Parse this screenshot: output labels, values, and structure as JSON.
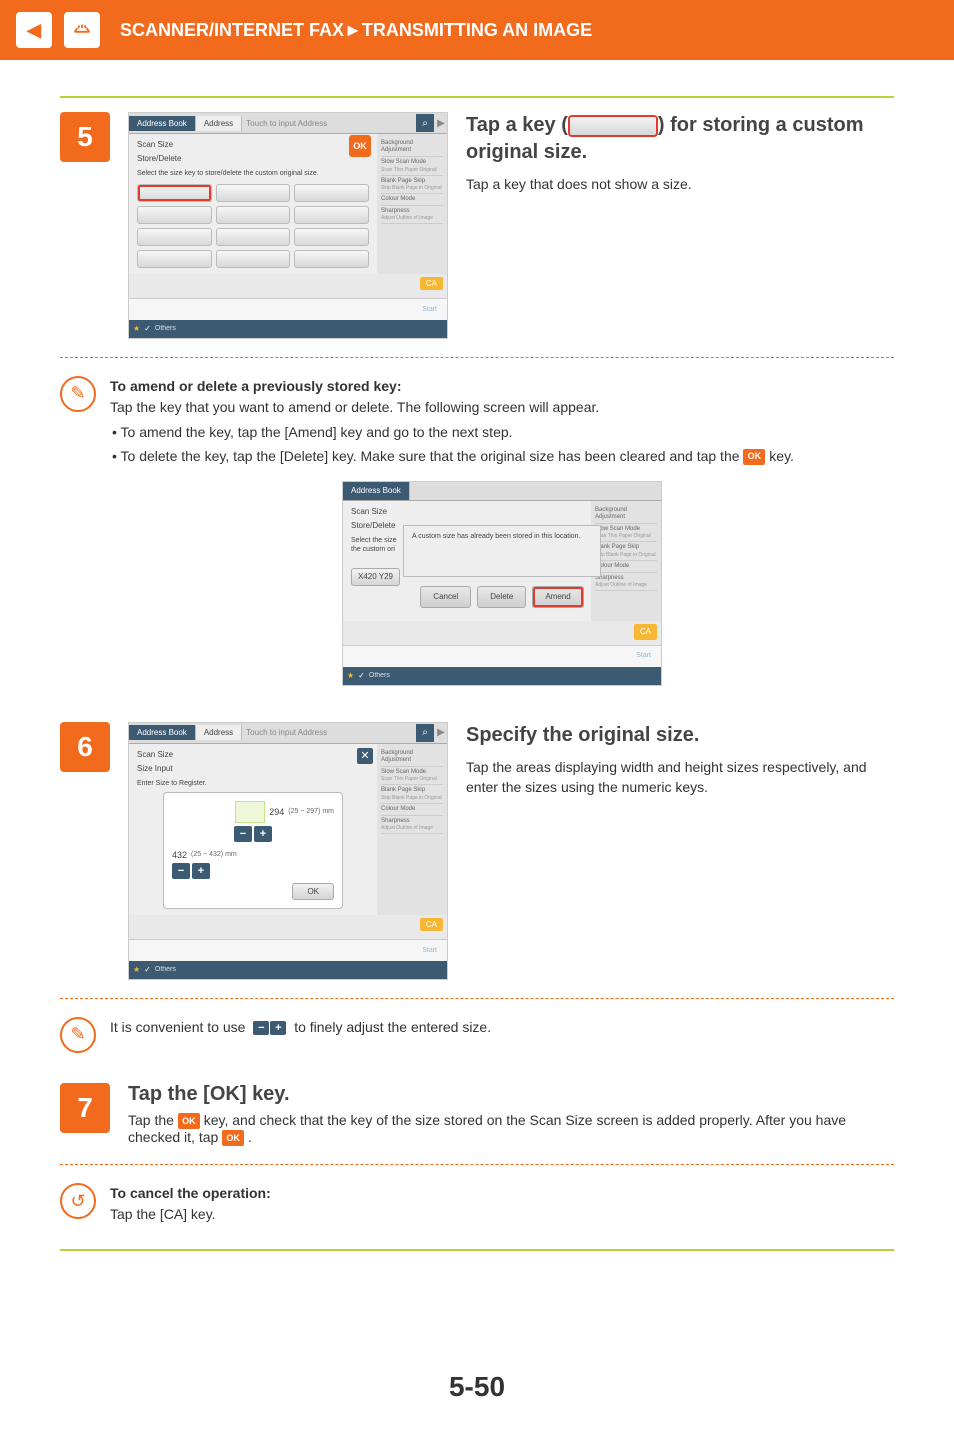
{
  "header": {
    "breadcrumb": "SCANNER/INTERNET FAX►TRANSMITTING AN IMAGE"
  },
  "step5": {
    "num": "5",
    "title_a": "Tap a key (",
    "title_b": ") for storing a custom original size.",
    "desc": "Tap a key that does not show a size."
  },
  "mock_common": {
    "tab_book": "Address Book",
    "tab_address": "Address",
    "hint": "Touch to input Address",
    "right": {
      "bg_adjust": "Background Adjustment",
      "slow": "Slow Scan Mode",
      "slow_sub": "Scan Thin Paper Original",
      "blank": "Blank Page Skip",
      "blank_sub": "Skip Blank Page in Original",
      "colour": "Colour Mode",
      "sharp": "Sharpness",
      "sharp_sub": "Adjust Outline of Image"
    },
    "ca": "CA",
    "ok": "OK",
    "others": "Others",
    "start": "Start"
  },
  "mock5": {
    "l1": "Scan Size",
    "l2": "Store/Delete",
    "subtitle": "Select the size key to store/delete the custom original size."
  },
  "amend_note": {
    "heading": "To amend or delete a previously stored key:",
    "line1": "Tap the key that you want to amend or delete. The following screen will appear.",
    "li1": "• To amend the key, tap the [Amend] key and go to the next step.",
    "li2_a": "• To delete the key, tap the [Delete] key. Make sure that the original size has been cleared and tap the ",
    "li2_b": " key.",
    "popup_msg": "A custom size has already been stored in this location.",
    "key_label": "X420 Y29",
    "btn_cancel": "Cancel",
    "btn_delete": "Delete",
    "btn_amend": "Amend"
  },
  "step6": {
    "num": "6",
    "title": "Specify the original size.",
    "desc": "Tap the areas displaying width and height sizes respectively, and enter the sizes using the numeric keys.",
    "l1": "Scan Size",
    "l2": "Size Input",
    "subtitle": "Enter Size to Register.",
    "w_value": "294",
    "w_range": "(25 ~ 297) mm",
    "h_value": "432",
    "h_range": "(25 ~ 432) mm",
    "ok": "OK"
  },
  "fine_note": {
    "a": "It is convenient to use ",
    "b": " to finely adjust the entered size."
  },
  "step7": {
    "num": "7",
    "title": "Tap the [OK] key.",
    "a": "Tap the ",
    "b": " key, and check that the key of the size stored on the Scan Size screen is added properly. After you have checked it, tap ",
    "c": " ."
  },
  "cancel_note": {
    "heading": "To cancel the operation:",
    "body": "Tap the [CA] key."
  },
  "page_num": "5-50",
  "ok_text": "OK"
}
